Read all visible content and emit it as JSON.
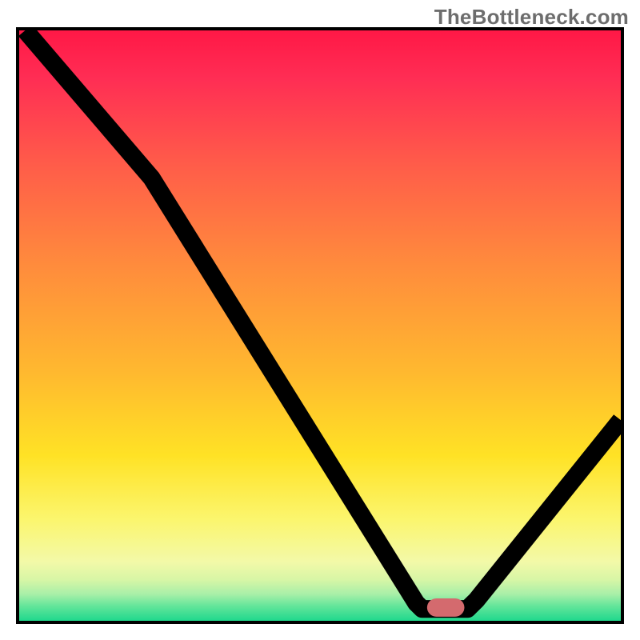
{
  "watermark": "TheBottleneck.com",
  "colors": {
    "gradient_top": "#ff1846",
    "gradient_mid": "#ffb92f",
    "gradient_yellow": "#fbf66f",
    "gradient_green": "#1fd88d",
    "curve": "#000000",
    "marker": "#d46a6e",
    "frame": "#000000"
  },
  "chart_data": {
    "type": "line",
    "title": "",
    "xlabel": "",
    "ylabel": "",
    "xlim": [
      0,
      100
    ],
    "ylim": [
      0,
      100
    ],
    "grid": false,
    "legend": false,
    "background": "vertical gradient red→orange→yellow→green (bottom)",
    "series": [
      {
        "name": "bottleneck-curve",
        "x": [
          1,
          22,
          66,
          67,
          74.5,
          76,
          100
        ],
        "values": [
          100,
          75,
          3,
          2,
          2,
          3.5,
          34
        ]
      }
    ],
    "annotations": [
      {
        "name": "optimal-marker",
        "shape": "rounded-rect",
        "x": 71,
        "y": 2,
        "color": "#d46a6e"
      }
    ]
  }
}
